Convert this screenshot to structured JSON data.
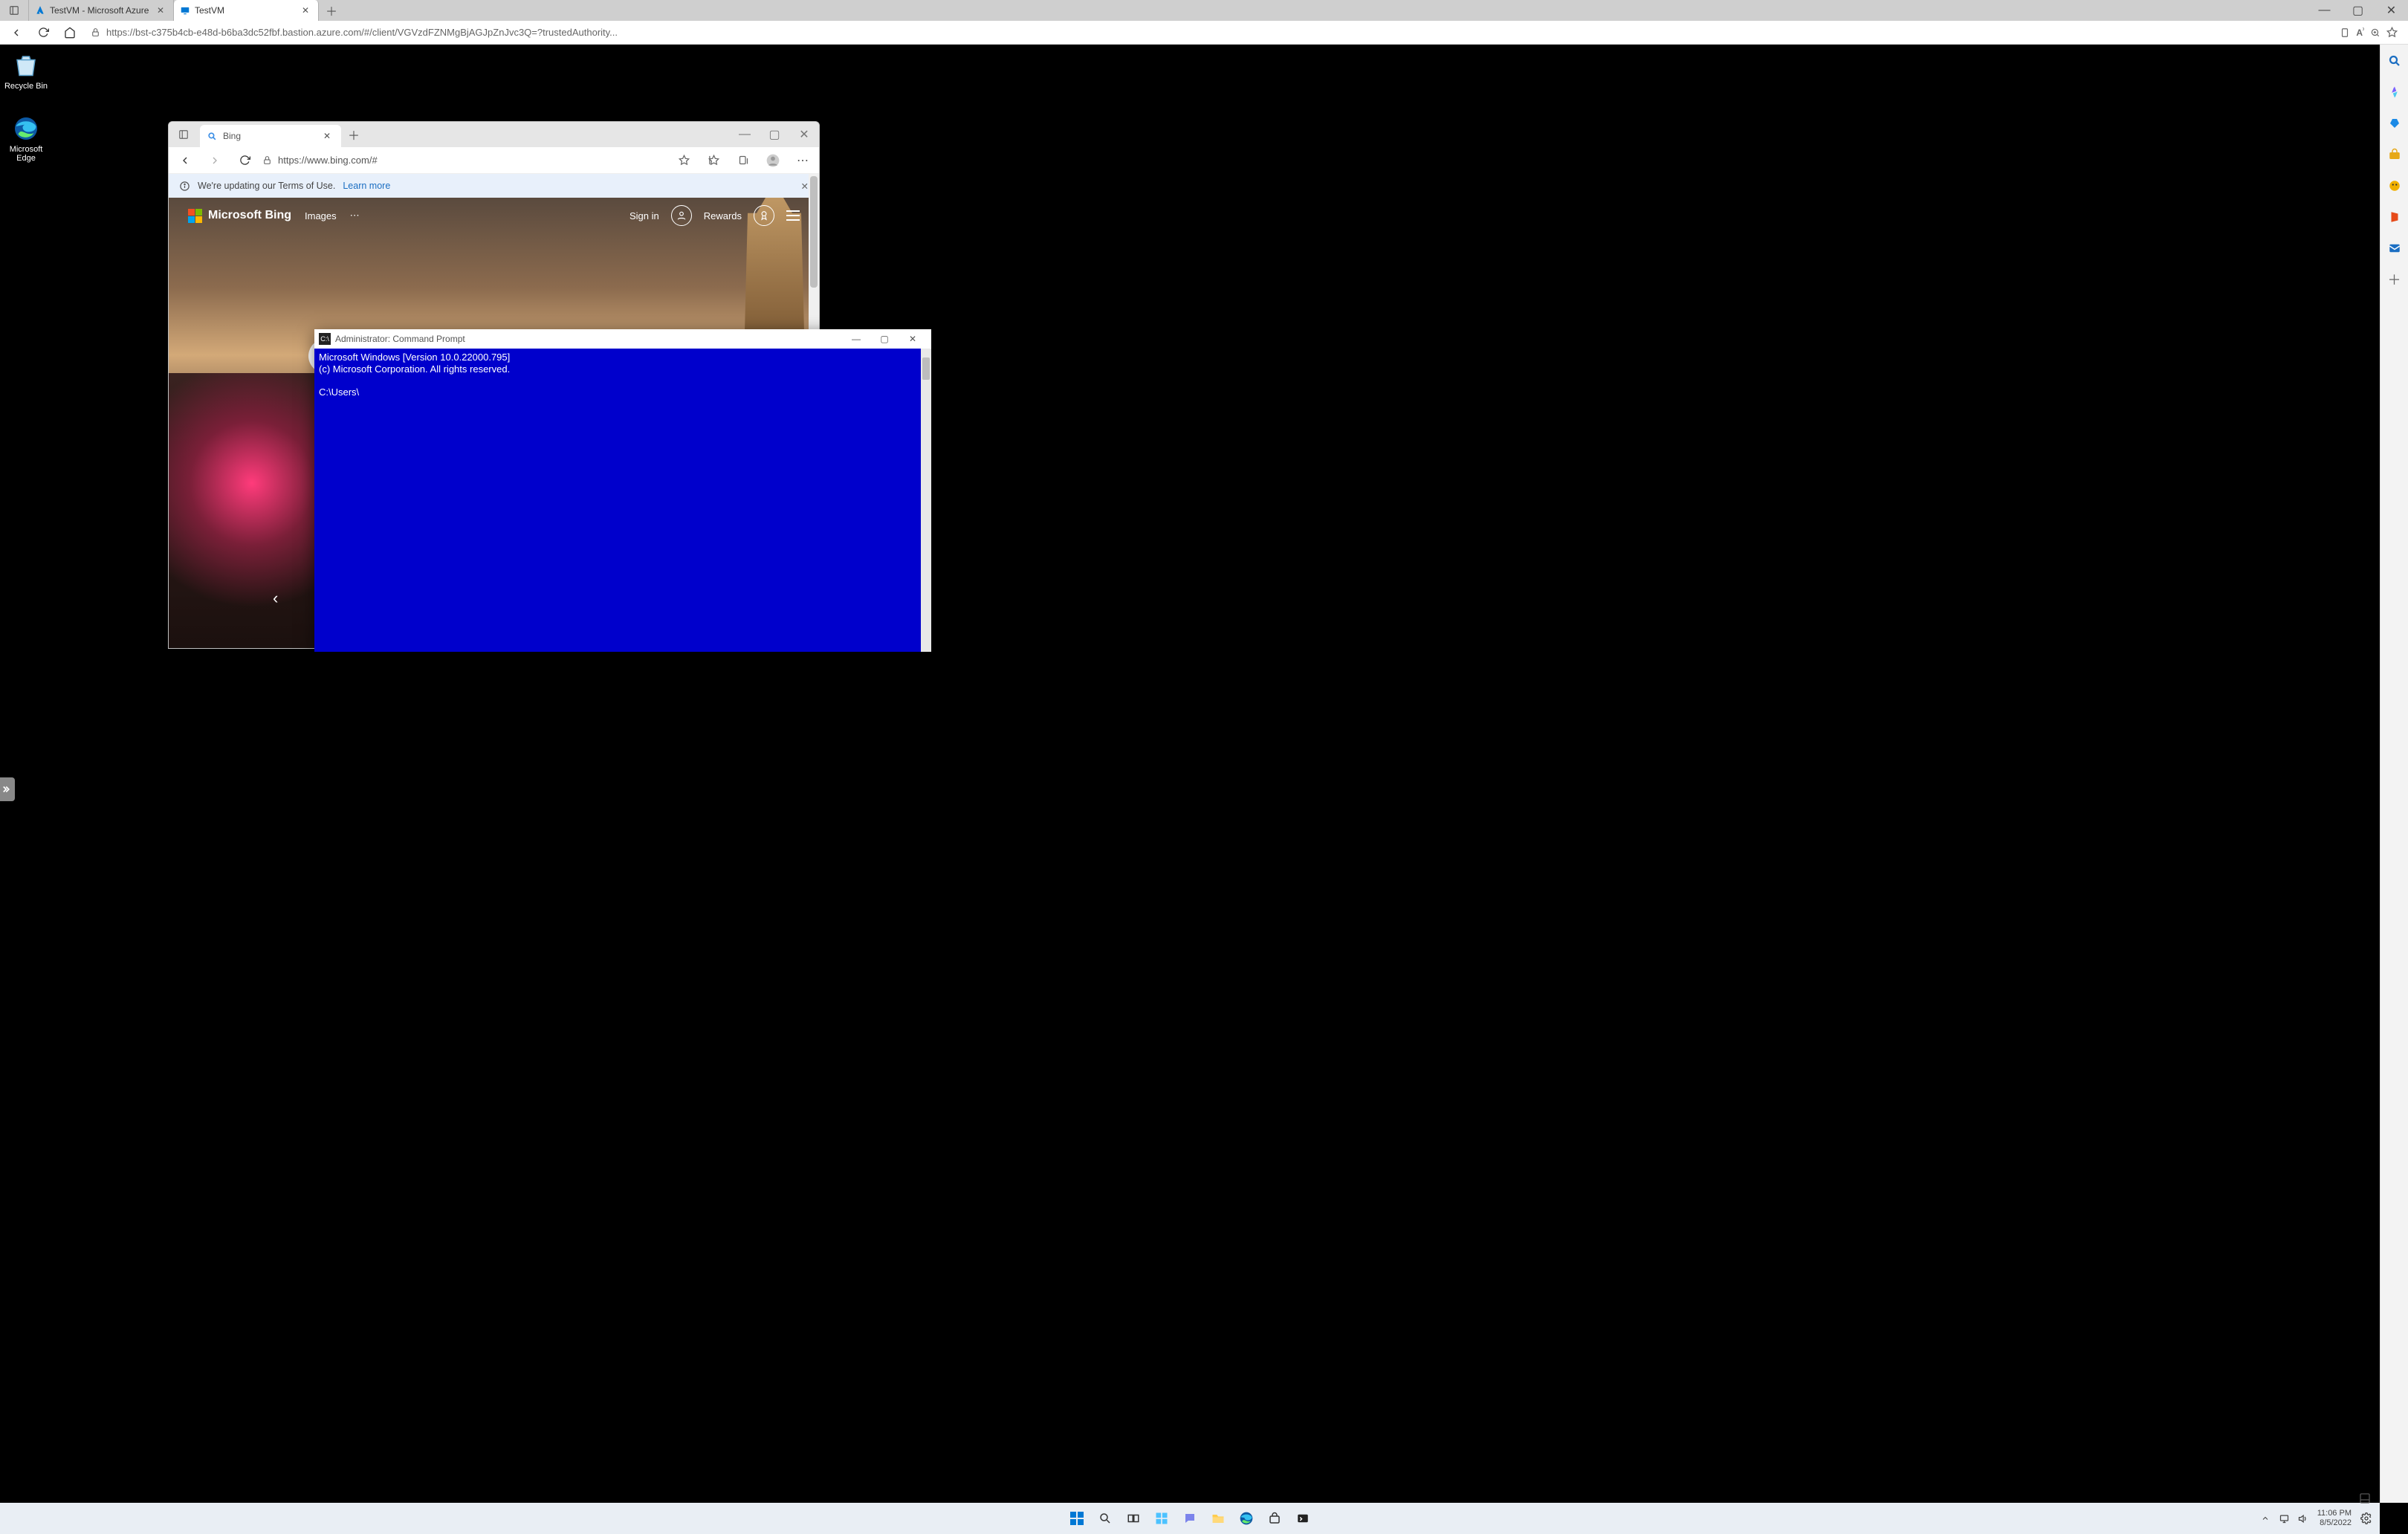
{
  "outer": {
    "tabs": [
      {
        "title": "TestVM  - Microsoft Azure",
        "icon": "azure"
      },
      {
        "title": "TestVM",
        "icon": "vm"
      }
    ],
    "active_tab": 1,
    "url": "https://bst-c375b4cb-e48d-b6ba3dc52fbf.bastion.azure.com/#/client/VGVzdFZNMgBjAGJpZnJvc3Q=?trustedAuthority..."
  },
  "remote": {
    "desktop_icons": [
      {
        "label": "Recycle Bin"
      },
      {
        "label": "Microsoft Edge"
      }
    ]
  },
  "inner_edge": {
    "tab_title": "Bing",
    "url": "https://www.bing.com/#",
    "notice_text": "We're updating our Terms of Use.",
    "notice_link": "Learn more",
    "bing": {
      "brand": "Microsoft Bing",
      "nav_images": "Images",
      "signin": "Sign in",
      "rewards": "Rewards",
      "search_placeholder": ""
    }
  },
  "cmd": {
    "title": "Administrator: Command Prompt",
    "line1": "Microsoft Windows [Version 10.0.22000.795]",
    "line2": "(c) Microsoft Corporation. All rights reserved.",
    "prompt": "C:\\Users\\"
  },
  "taskbar": {
    "time": "11:06 PM",
    "date": "8/5/2022"
  }
}
